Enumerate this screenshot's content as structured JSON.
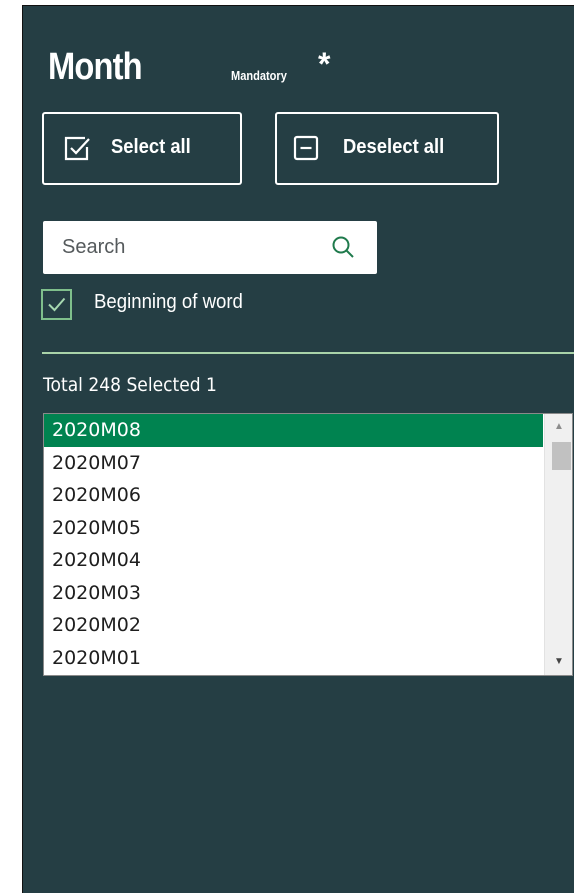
{
  "header": {
    "title": "Month",
    "mandatory_label": "Mandatory",
    "required_marker": "*"
  },
  "actions": {
    "select_all_label": "Select all",
    "deselect_all_label": "Deselect all"
  },
  "search": {
    "placeholder": "Search",
    "value": ""
  },
  "options": {
    "beginning_of_word_label": "Beginning of word",
    "beginning_of_word_checked": true
  },
  "summary": {
    "text": "Total 248 Selected 1"
  },
  "list": {
    "items": [
      {
        "label": "2020M08",
        "selected": true
      },
      {
        "label": "2020M07",
        "selected": false
      },
      {
        "label": "2020M06",
        "selected": false
      },
      {
        "label": "2020M05",
        "selected": false
      },
      {
        "label": "2020M04",
        "selected": false
      },
      {
        "label": "2020M03",
        "selected": false
      },
      {
        "label": "2020M02",
        "selected": false
      },
      {
        "label": "2020M01",
        "selected": false
      }
    ],
    "scroll_up_glyph": "▲",
    "scroll_down_glyph": "▼"
  },
  "colors": {
    "panel_background": "#253e44",
    "selected_row": "#008350",
    "divider": "#a9d3a9",
    "checkbox_accent": "#7fbf8c"
  },
  "icons": {
    "select_all": "checkbox-checked-icon",
    "deselect_all": "checkbox-minus-icon",
    "search": "search-icon",
    "checkbox": "checkmark-icon"
  }
}
